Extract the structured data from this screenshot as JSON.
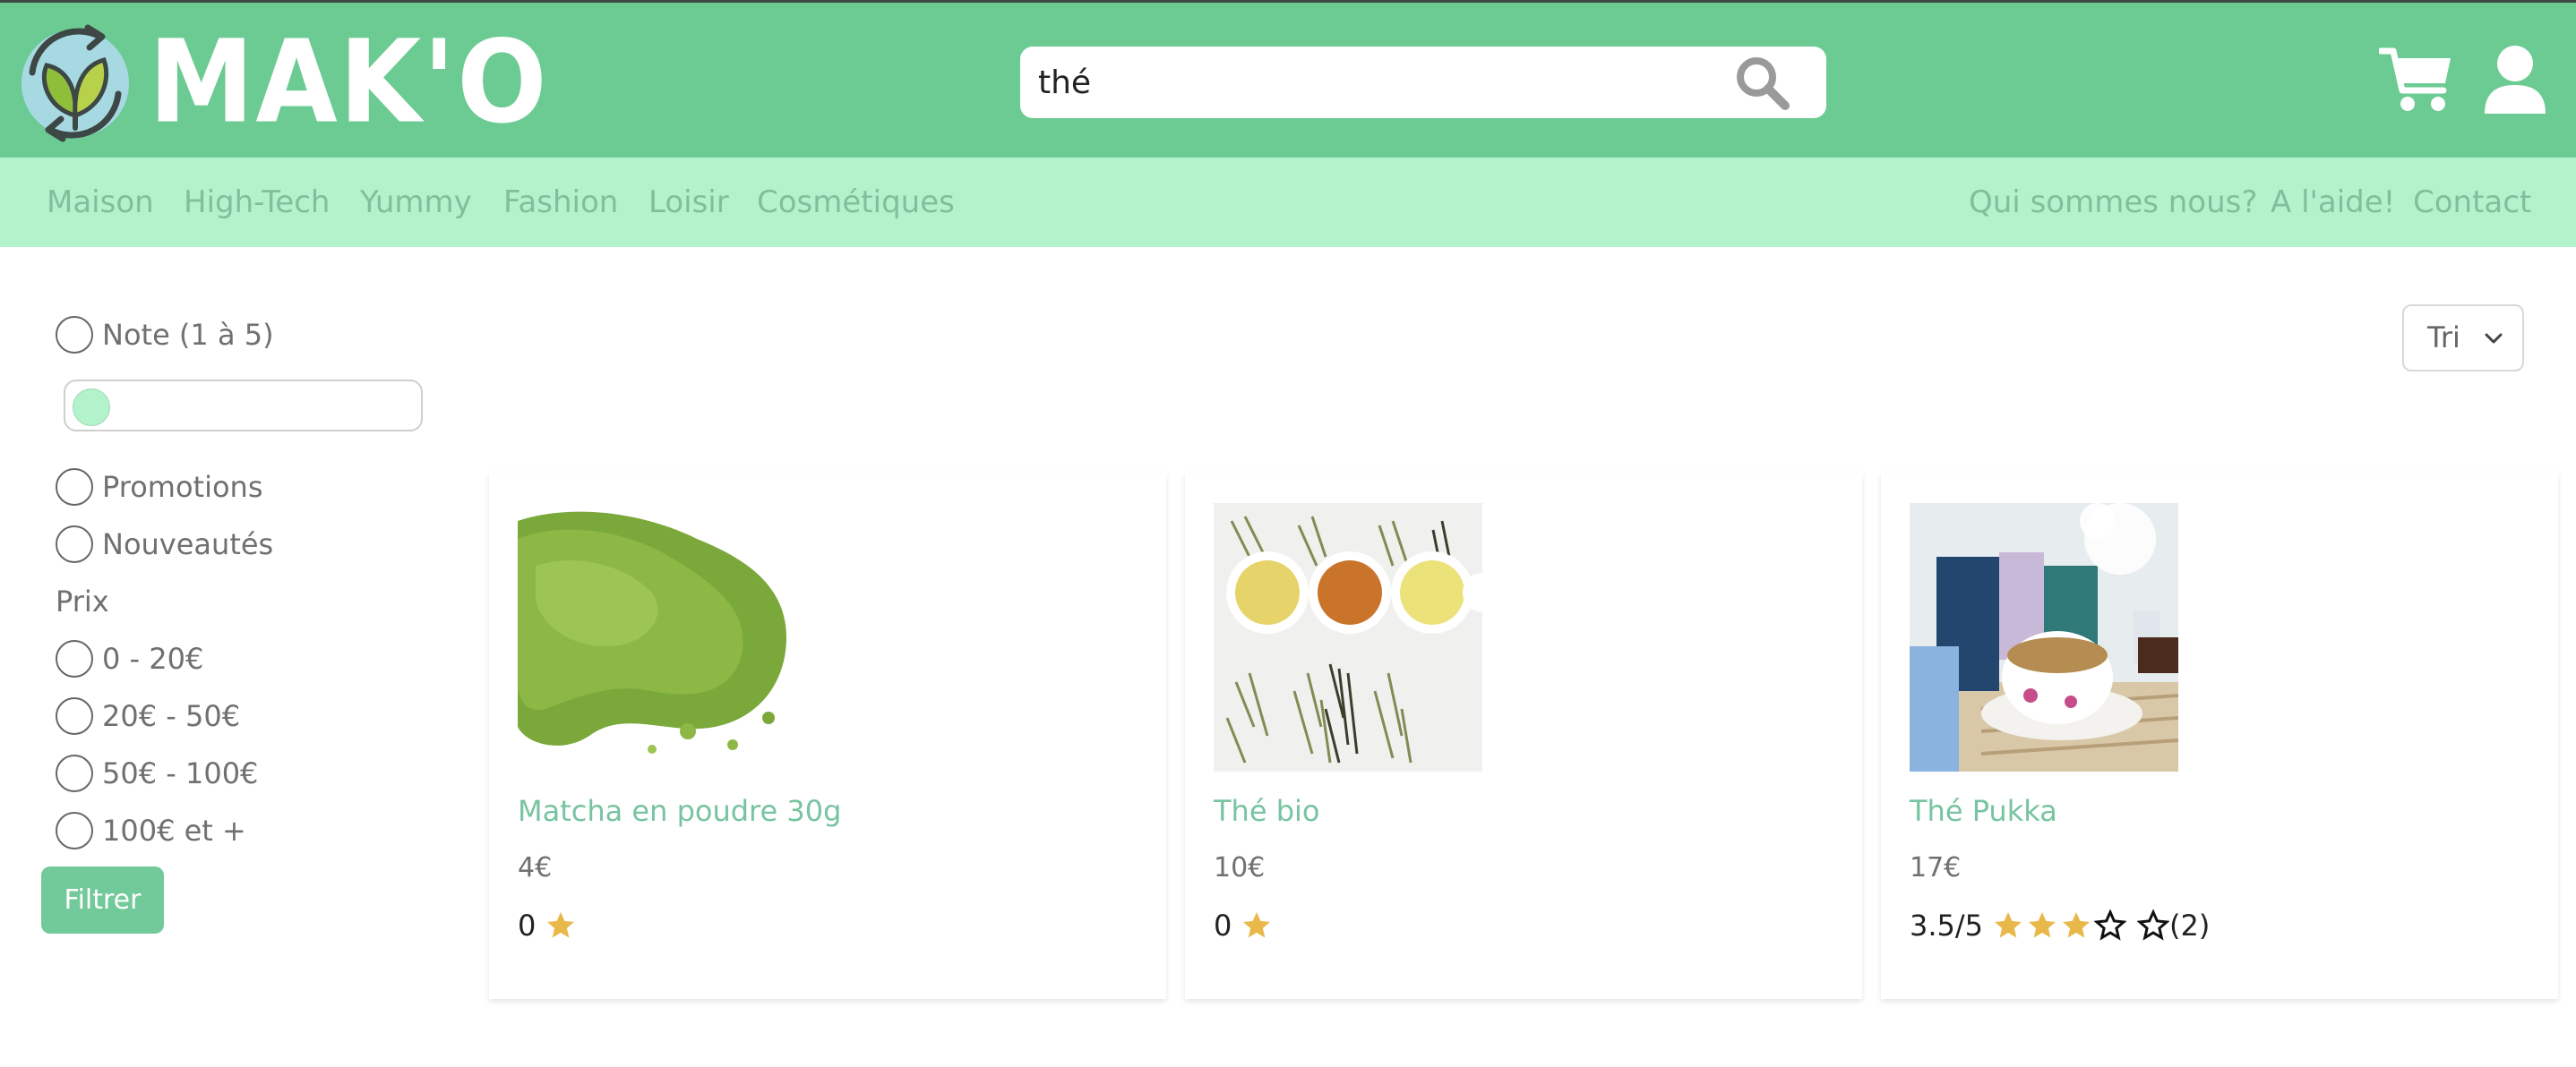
{
  "brand": {
    "name": "MAK'O"
  },
  "search": {
    "value": "thé"
  },
  "nav": {
    "categories": [
      "Maison",
      "High-Tech",
      "Yummy",
      "Fashion",
      "Loisir",
      "Cosmétiques"
    ],
    "info_links": [
      "Qui sommes nous?",
      "A l'aide!",
      "Contact"
    ]
  },
  "filters": {
    "rating_label": "Note (1 à 5)",
    "rating_slider_value": 0,
    "promotions_label": "Promotions",
    "new_label": "Nouveautés",
    "price_heading": "Prix",
    "price_ranges": [
      "0 - 20€",
      "20€ - 50€",
      "50€ - 100€",
      "100€ et +"
    ],
    "filter_button": "Filtrer"
  },
  "sort": {
    "label": "Tri"
  },
  "products": [
    {
      "name": "Matcha en poudre 30g",
      "price": "4€",
      "rating_text": "0",
      "stars_filled": 1,
      "stars_empty": 0,
      "review_count": "",
      "image": "matcha-powder"
    },
    {
      "name": "Thé bio",
      "price": "10€",
      "rating_text": "0",
      "stars_filled": 1,
      "stars_empty": 0,
      "review_count": "",
      "image": "tea-bowls"
    },
    {
      "name": "Thé Pukka",
      "price": "17€",
      "rating_text": "3.5/5",
      "stars_filled": 3,
      "stars_empty": 2,
      "review_count": "(2)",
      "image": "pukka-tea"
    }
  ],
  "colors": {
    "header": "#6ccb93",
    "nav": "#b3f3cc",
    "accent": "#72c99a",
    "link": "#78c4a0",
    "star": "#e8b84a"
  }
}
